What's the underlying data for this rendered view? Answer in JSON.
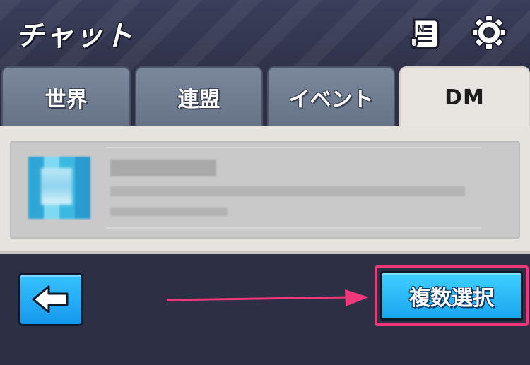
{
  "header": {
    "title": "チャット",
    "icons": {
      "news": "news-icon",
      "settings": "gear-icon"
    }
  },
  "tabs": [
    {
      "label": "世界",
      "active": false
    },
    {
      "label": "連盟",
      "active": false
    },
    {
      "label": "イベント",
      "active": false
    },
    {
      "label": "DM",
      "active": true
    }
  ],
  "dm_list": {
    "items": [
      {
        "avatar": "avatar-image",
        "blurred": true
      }
    ]
  },
  "footer": {
    "back_icon": "arrow-left-icon",
    "multi_select_label": "複数選択"
  },
  "colors": {
    "background": "#2d2f44",
    "tab_inactive": "#6f7b90",
    "tab_active": "#e8e4df",
    "button_blue": "#1ea8f0",
    "highlight_pink": "#f0377a"
  }
}
